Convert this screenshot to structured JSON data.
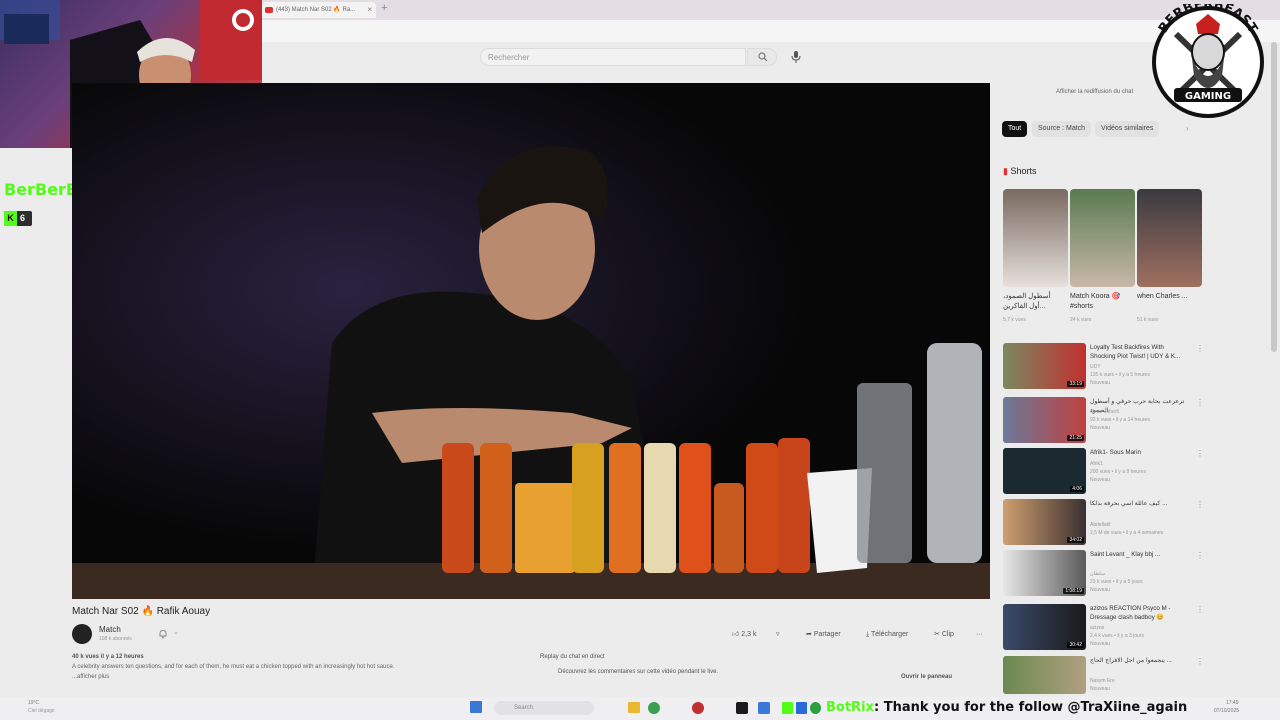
{
  "browser": {
    "tab_title": "(443) Match Nar S02 🔥 Ra...",
    "tab_close": "×",
    "new_tab": "+"
  },
  "search": {
    "placeholder": "Rechercher"
  },
  "video": {
    "title": "Match Nar S02 🔥 Rafik Aouay",
    "channel": "Match",
    "subscribers": "108 k abonnés",
    "actions": {
      "likes": "2,3 k",
      "share": "Partager",
      "download": "Télécharger",
      "clip": "Clip",
      "more": "···"
    },
    "description": {
      "stats": "40 k vues  il y a 12 heures",
      "text": "A celebrity answers ten questions, and for each of them, he must eat a chicken topped with an increasingly hot hot sauce.",
      "more": "...afficher plus"
    },
    "chat_replay": {
      "title": "Replay du chat en direct",
      "text": "Découvrez les commentaires sur cette vidéo pendant le live.",
      "button": "Ouvrir le panneau"
    }
  },
  "sidebar": {
    "chat_replay_link": "Afficher la rediffusion du chat",
    "chips": [
      "Tout",
      "Source : Match",
      "Vidéos similaires"
    ],
    "shorts_heading": "Shorts",
    "shorts": [
      {
        "title": "أسطول الصمود، أول الفاكرين...",
        "views": "5,7 k vues"
      },
      {
        "title": "Match Koora 🎯 #shorts",
        "views": "24 k vues"
      },
      {
        "title": "when Charles ...",
        "views": "51 k vues"
      }
    ],
    "recommendations": [
      {
        "title": "Loyalty Test Backfires With Shocking Plot Twist! | UDY & K...",
        "channel": "UDY",
        "meta": "135 k vues • il y a 5 heures",
        "badge": "Nouveau",
        "duration": "33:19"
      },
      {
        "title": "ترعرعت بحاية حرب حرفي و أسطول الصمود",
        "channel": "Omar Jafardi",
        "meta": "92 k vues • il y a 14 heures",
        "badge": "Nouveau",
        "duration": "21:25"
      },
      {
        "title": "Afrik1- Sous Marin",
        "channel": "Afrik1",
        "meta": "200 vues • il y a 9 heures",
        "badge": "Nouveau",
        "duration": "4:06"
      },
      {
        "title": "كيف عائلة اسي بحرفة بذلكا ...",
        "channel": "Abdellatif",
        "meta": "2,5 M de vues • il y a 4 semaines",
        "badge": "",
        "duration": "34:02"
      },
      {
        "title": "Saint Levant _ Klay bbj ...",
        "channel": "سلطان",
        "meta": "23 k vues • il y a 5 jours",
        "badge": "Nouveau",
        "duration": "1:08:19"
      },
      {
        "title": "azizos REACTION Psyco M - Dressage clash badboy 😊",
        "channel": "azizos",
        "meta": "2,4 k vues • il y a 3 jours",
        "badge": "Nouveau",
        "duration": "30:42"
      },
      {
        "title": "ينجمعوا من اجل الافراج الحاج ...",
        "channel": "Nasym Ere",
        "meta": "",
        "badge": "Nouveau",
        "duration": ""
      }
    ]
  },
  "overlay": {
    "streamer_name": "BerBerBeast",
    "kick_viewers": "6",
    "logo_text_top": "BERBERBEAST",
    "logo_text_bottom": "GAMING",
    "chat_user": "BotRix",
    "chat_message": ": Thank you for the follow @TraXiine_again"
  },
  "taskbar": {
    "weather": "19°C",
    "weather_desc": "Ciel dégagé",
    "search": "Search",
    "time": "17:49",
    "date": "07/10/2025"
  },
  "colors": {
    "kick_green": "#53fc18",
    "youtube_red": "#e03030"
  }
}
